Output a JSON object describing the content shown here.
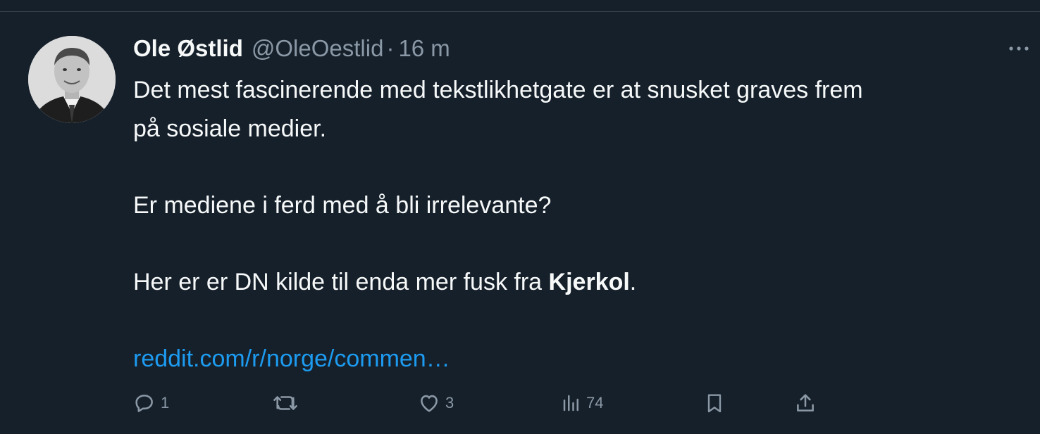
{
  "tweet": {
    "author": {
      "display_name": "Ole Østlid",
      "handle": "@OleOestlid",
      "separator": "·",
      "time": "16 m"
    },
    "body": {
      "line1": "Det mest fascinerende med tekstlikhetgate er at snusket graves frem",
      "line2": "på sosiale medier.",
      "line3": "Er mediene i ferd med å bli irrelevante?",
      "line4_prefix": "Her er er DN kilde til enda mer fusk fra ",
      "line4_bold": "Kjerkol",
      "line4_suffix": ".",
      "link": "reddit.com/r/norge/commen…"
    },
    "actions": {
      "replies": "1",
      "retweets": "",
      "likes": "3",
      "views": "74"
    },
    "icons": {
      "reply": "reply-icon",
      "retweet": "retweet-icon",
      "like": "heart-icon",
      "views": "views-icon",
      "bookmark": "bookmark-icon",
      "share": "share-icon",
      "more": "more-icon"
    }
  },
  "colors": {
    "background": "#15202b",
    "text": "#f7f9f9",
    "muted": "#8b98a5",
    "link": "#1d9bf0",
    "divider": "#38444d"
  }
}
